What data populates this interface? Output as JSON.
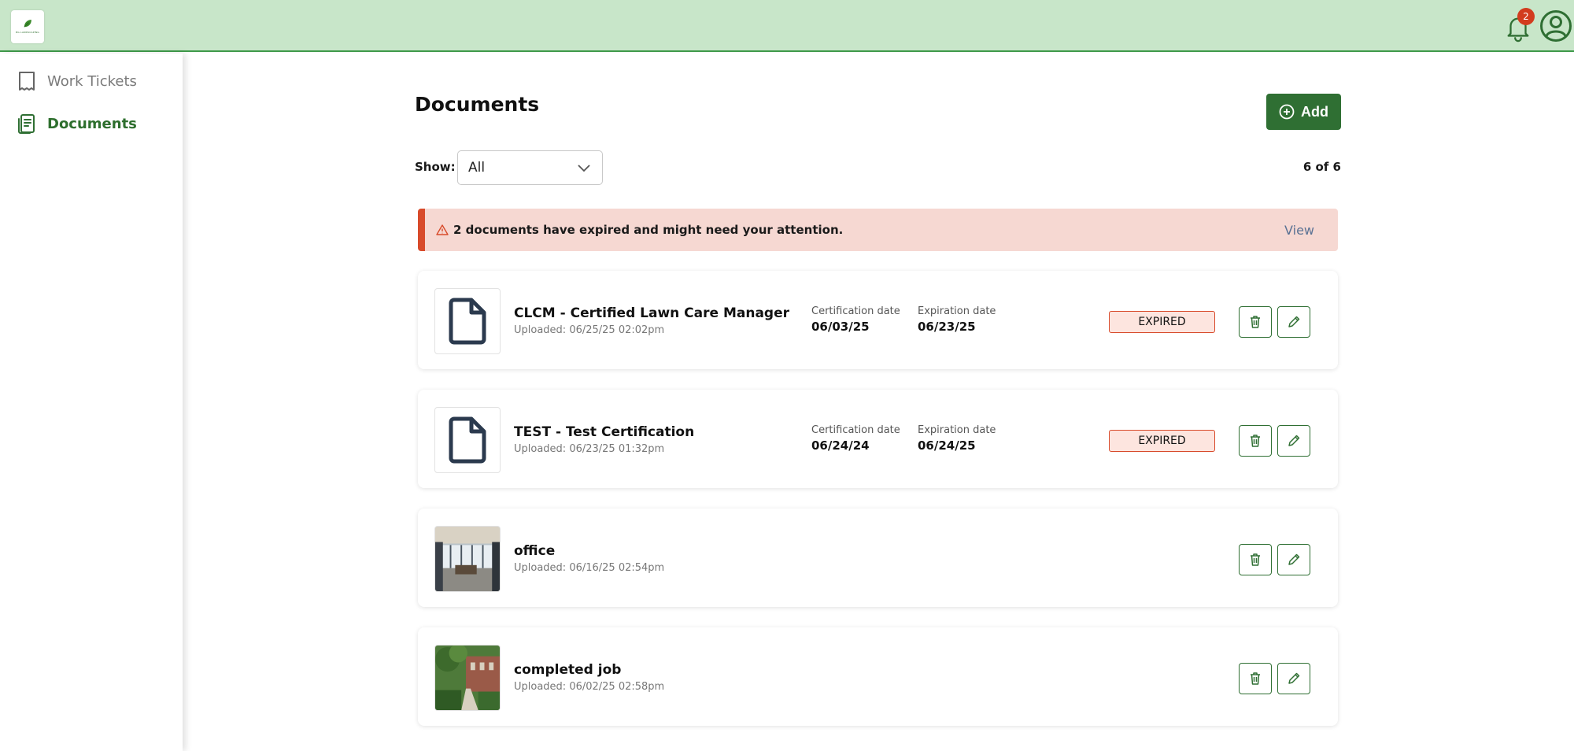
{
  "header": {
    "logo_text": "BG LANDSCAPING",
    "notification_count": "2"
  },
  "sidebar": {
    "items": [
      {
        "label": "Work Tickets",
        "icon": "receipt-icon",
        "active": false
      },
      {
        "label": "Documents",
        "icon": "document-list-icon",
        "active": true
      }
    ]
  },
  "main": {
    "title": "Documents",
    "add_label": "Add",
    "show_label": "Show:",
    "filter_value": "All",
    "count": "6 of 6",
    "alert": {
      "text": "2 documents have expired and might need your attention.",
      "view_label": "View"
    },
    "documents": [
      {
        "name": "CLCM - Certified Lawn Care Manager",
        "uploaded": "Uploaded: 06/25/25 02:02pm",
        "thumb": "file-icon",
        "cert_label": "Certification date",
        "cert_date": "06/03/25",
        "exp_label": "Expiration date",
        "exp_date": "06/23/25",
        "status": "EXPIRED"
      },
      {
        "name": "TEST - Test Certification",
        "uploaded": "Uploaded: 06/23/25 01:32pm",
        "thumb": "file-icon",
        "cert_label": "Certification date",
        "cert_date": "06/24/24",
        "exp_label": "Expiration date",
        "exp_date": "06/24/25",
        "status": "EXPIRED"
      },
      {
        "name": "office",
        "uploaded": "Uploaded: 06/16/25 02:54pm",
        "thumb": "office-photo"
      },
      {
        "name": "completed job",
        "uploaded": "Uploaded: 06/02/25 02:58pm",
        "thumb": "garden-photo"
      }
    ]
  },
  "colors": {
    "header_bg": "#c8e6c9",
    "brand_green": "#2f6f33",
    "alert_bg": "#f6d8d2",
    "alert_accent": "#d84a2a"
  }
}
